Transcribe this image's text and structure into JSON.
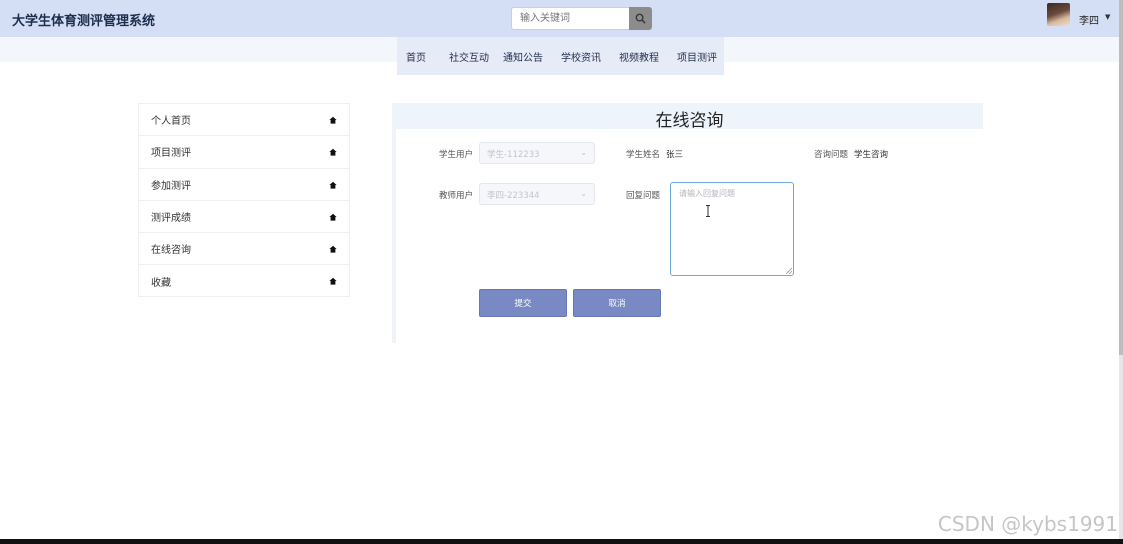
{
  "header": {
    "app_title": "大学生体育测评管理系统",
    "search_placeholder": "输入关键词",
    "search_icon": "search-icon",
    "user_name": "李四",
    "user_menu_icon": "caret-down-icon"
  },
  "nav": {
    "items": [
      "首页",
      "社交互动",
      "通知公告",
      "学校资讯",
      "视频教程",
      "项目测评"
    ]
  },
  "sidebar": {
    "items": [
      {
        "label": "个人首页",
        "icon": "home-icon"
      },
      {
        "label": "项目测评",
        "icon": "home-icon"
      },
      {
        "label": "参加测评",
        "icon": "home-icon"
      },
      {
        "label": "测评成绩",
        "icon": "home-icon"
      },
      {
        "label": "在线咨询",
        "icon": "home-icon"
      },
      {
        "label": "收藏",
        "icon": "home-icon"
      }
    ]
  },
  "form": {
    "title": "在线咨询",
    "student_user_label": "学生用户",
    "student_user_value": "学生-112233",
    "student_name_label": "学生姓名",
    "student_name_value": "张三",
    "question_label": "咨询问题",
    "question_value": "学生咨询",
    "teacher_user_label": "教师用户",
    "teacher_user_value": "李四-223344",
    "reply_label": "回复问题",
    "reply_placeholder": "请输入回复问题",
    "submit_label": "提交",
    "cancel_label": "取消"
  },
  "watermark": "CSDN @kybs1991",
  "colors": {
    "header_bg": "#d4dff5",
    "nav_bg": "#e6ecf7",
    "button_bg": "#7889c3",
    "focus_border": "#6fa7dd"
  }
}
